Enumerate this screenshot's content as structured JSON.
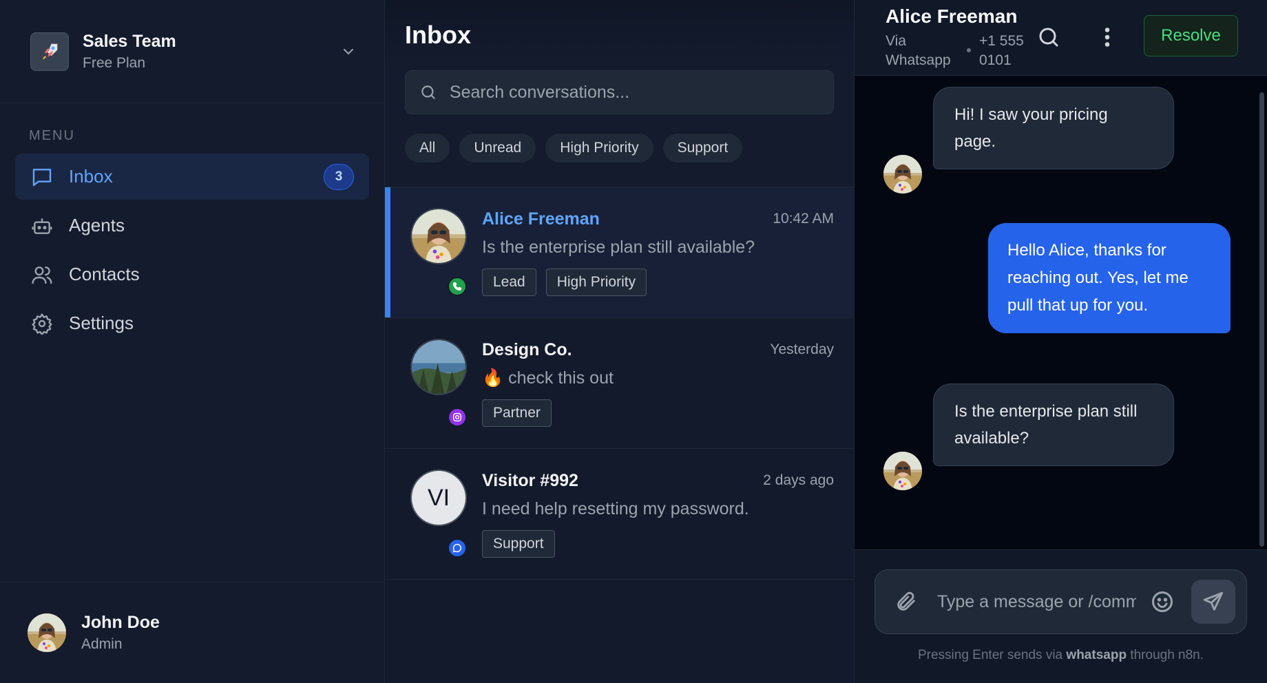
{
  "sidebar": {
    "team": {
      "name": "Sales Team",
      "plan": "Free Plan",
      "logo_icon": "rocket-icon"
    },
    "menu_heading": "MENU",
    "items": [
      {
        "label": "Inbox",
        "icon": "inbox-icon",
        "badge": "3",
        "active": true
      },
      {
        "label": "Agents",
        "icon": "robot-icon"
      },
      {
        "label": "Contacts",
        "icon": "users-icon"
      },
      {
        "label": "Settings",
        "icon": "gear-icon"
      }
    ],
    "user": {
      "name": "John Doe",
      "role": "Admin"
    }
  },
  "inbox": {
    "title": "Inbox",
    "search_placeholder": "Search conversations...",
    "filters": [
      "All",
      "Unread",
      "High Priority",
      "Support"
    ],
    "conversations": [
      {
        "name": "Alice Freeman",
        "time": "10:42 AM",
        "preview": "Is the enterprise plan still available?",
        "tags": [
          "Lead",
          "High Priority"
        ],
        "channel": "whatsapp",
        "active": true
      },
      {
        "name": "Design Co.",
        "time": "Yesterday",
        "preview": "🔥 check this out",
        "tags": [
          "Partner"
        ],
        "channel": "instagram"
      },
      {
        "name": "Visitor #992",
        "initials": "VI",
        "time": "2 days ago",
        "preview": "I need help resetting my password.",
        "tags": [
          "Support"
        ],
        "channel": "webchat"
      }
    ]
  },
  "chat": {
    "contact_name": "Alice Freeman",
    "via": "Via Whatsapp",
    "phone": "+1 555 0101",
    "resolve_label": "Resolve",
    "messages": [
      {
        "direction": "in",
        "text": "Hi! I saw your pricing page."
      },
      {
        "direction": "out",
        "text": "Hello Alice, thanks for reaching out. Yes, let me pull that up for you."
      },
      {
        "direction": "in",
        "text": "Is the enterprise plan still available?"
      }
    ],
    "composer_placeholder": "Type a message or /command",
    "hint_prefix": "Pressing Enter sends via ",
    "hint_channel": "whatsapp",
    "hint_suffix": " through n8n."
  },
  "colors": {
    "accent": "#3b82f6",
    "background": "#111827",
    "resolve_green": "#4ade80",
    "whatsapp": "#22a04b",
    "instagram": "#9333ea",
    "webchat": "#2563eb"
  }
}
